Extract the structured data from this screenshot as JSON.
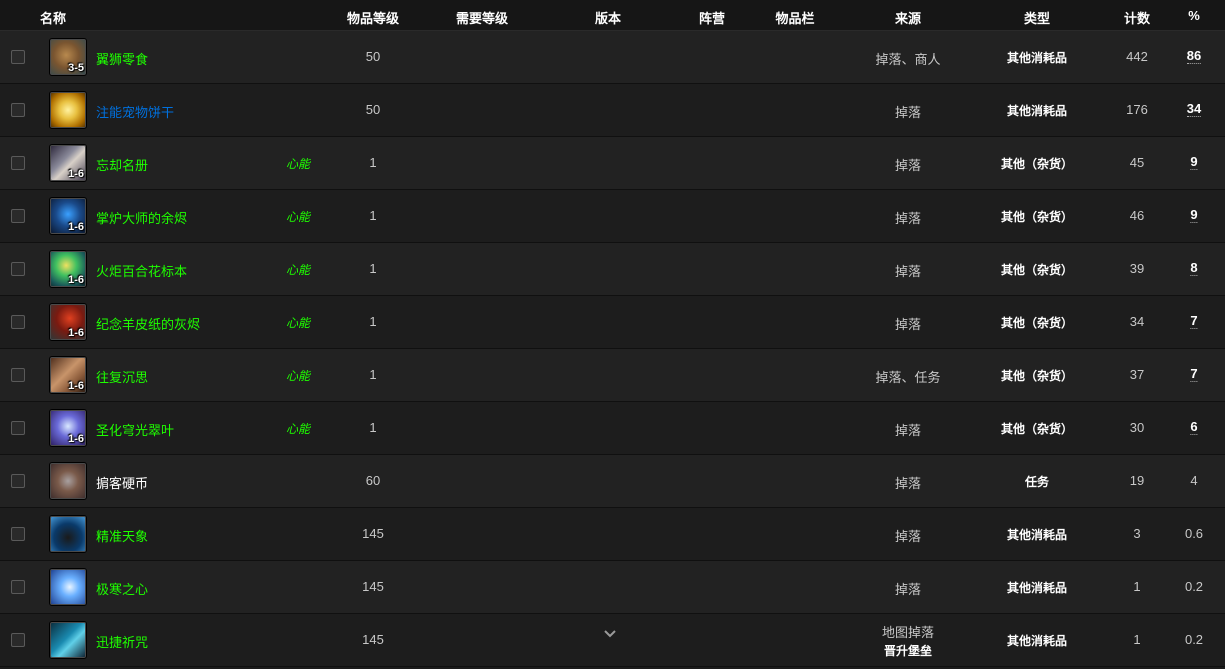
{
  "header": {
    "name": "名称",
    "item_level": "物品等级",
    "req_level": "需要等级",
    "version": "版本",
    "faction": "阵营",
    "slot": "物品栏",
    "source": "来源",
    "type": "类型",
    "count": "计数",
    "percent": "%"
  },
  "colors": {
    "uncommon_green": "#1eff00",
    "rare_blue": "#0070dd",
    "common_white": "#ffffff"
  },
  "rows": [
    {
      "name": "翼狮零食",
      "quality": "green",
      "qty": "3-5",
      "tag": "",
      "item_level": "50",
      "source": "掉落、商人",
      "type": "其他消耗品",
      "count": "442",
      "percent": "86",
      "icon": "food-icon"
    },
    {
      "name": "注能宠物饼干",
      "quality": "blue",
      "qty": "",
      "tag": "",
      "item_level": "50",
      "source": "掉落",
      "type": "其他消耗品",
      "count": "176",
      "percent": "34",
      "icon": "biscuit-icon"
    },
    {
      "name": "忘却名册",
      "quality": "green",
      "qty": "1-6",
      "tag": "心能",
      "item_level": "1",
      "source": "掉落",
      "type": "其他（杂货）",
      "count": "45",
      "percent": "9",
      "icon": "scroll-icon"
    },
    {
      "name": "掌炉大师的余烬",
      "quality": "green",
      "qty": "1-6",
      "tag": "心能",
      "item_level": "1",
      "source": "掉落",
      "type": "其他（杂货）",
      "count": "46",
      "percent": "9",
      "icon": "ember-icon"
    },
    {
      "name": "火炬百合花标本",
      "quality": "green",
      "qty": "1-6",
      "tag": "心能",
      "item_level": "1",
      "source": "掉落",
      "type": "其他（杂货）",
      "count": "39",
      "percent": "8",
      "icon": "flower-icon"
    },
    {
      "name": "纪念羊皮纸的灰烬",
      "quality": "green",
      "qty": "1-6",
      "tag": "心能",
      "item_level": "1",
      "source": "掉落",
      "type": "其他（杂货）",
      "count": "34",
      "percent": "7",
      "icon": "ash-icon"
    },
    {
      "name": "往复沉思",
      "quality": "green",
      "qty": "1-6",
      "tag": "心能",
      "item_level": "1",
      "source": "掉落、任务",
      "type": "其他（杂货）",
      "count": "37",
      "percent": "7",
      "icon": "tome-icon"
    },
    {
      "name": "圣化穹光翠叶",
      "quality": "green",
      "qty": "1-6",
      "tag": "心能",
      "item_level": "1",
      "source": "掉落",
      "type": "其他（杂货）",
      "count": "30",
      "percent": "6",
      "icon": "leaf-icon"
    },
    {
      "name": "掮客硬币",
      "quality": "white",
      "qty": "",
      "tag": "",
      "item_level": "60",
      "source": "掉落",
      "type": "任务",
      "count": "19",
      "percent": "4",
      "icon": "coin-icon"
    },
    {
      "name": "精准天象",
      "quality": "green",
      "qty": "",
      "tag": "",
      "item_level": "145",
      "source": "掉落",
      "type": "其他消耗品",
      "count": "3",
      "percent": "0.6",
      "icon": "tree-icon"
    },
    {
      "name": "极寒之心",
      "quality": "green",
      "qty": "",
      "tag": "",
      "item_level": "145",
      "source": "掉落",
      "type": "其他消耗品",
      "count": "1",
      "percent": "0.2",
      "icon": "frost-icon"
    },
    {
      "name": "迅捷祈咒",
      "quality": "green",
      "qty": "",
      "tag": "",
      "item_level": "145",
      "source": "地图掉落",
      "source2": "晋升堡垒",
      "type": "其他消耗品",
      "count": "1",
      "percent": "0.2",
      "icon": "rune-icon"
    }
  ]
}
